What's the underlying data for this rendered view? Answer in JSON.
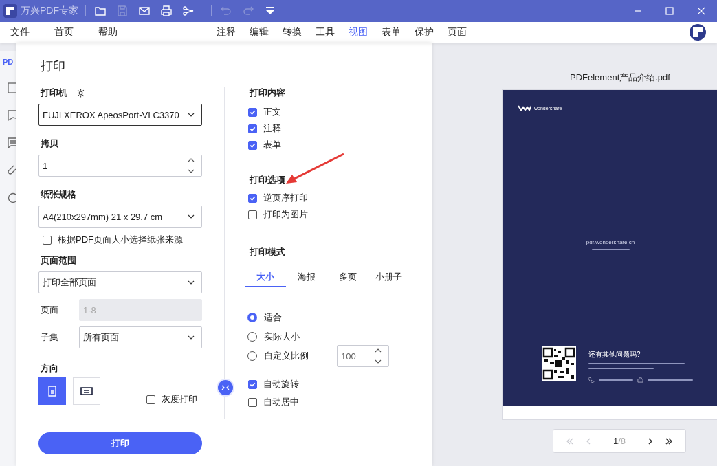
{
  "app": {
    "title": "万兴PDF专家"
  },
  "toolbar": [
    {
      "kind": "folder",
      "disabled": false
    },
    {
      "kind": "save",
      "disabled": true
    },
    {
      "kind": "mail",
      "disabled": false
    },
    {
      "kind": "print",
      "disabled": false
    },
    {
      "kind": "share",
      "disabled": false
    },
    {
      "kind": "undo",
      "disabled": true
    },
    {
      "kind": "redo",
      "disabled": true
    },
    {
      "kind": "dropdown",
      "disabled": false
    }
  ],
  "menu_left": [
    {
      "label": "文件"
    },
    {
      "label": "首页"
    },
    {
      "label": "帮助"
    }
  ],
  "menu_tabs": [
    {
      "label": "注释",
      "selected": false
    },
    {
      "label": "编辑",
      "selected": false
    },
    {
      "label": "转换",
      "selected": false
    },
    {
      "label": "工具",
      "selected": false
    },
    {
      "label": "视图",
      "selected": true
    },
    {
      "label": "表单",
      "selected": false
    },
    {
      "label": "保护",
      "selected": false
    },
    {
      "label": "页面",
      "selected": false
    }
  ],
  "sidebar": {
    "tab": "PD"
  },
  "dialog": {
    "title": "打印",
    "printer": {
      "label": "打印机",
      "value": "FUJI XEROX ApeosPort-VI C3370"
    },
    "copies": {
      "label": "拷贝",
      "value": "1"
    },
    "paper": {
      "label": "纸张规格",
      "value": "A4(210x297mm) 21 x 29.7 cm",
      "source": {
        "label": "根据PDF页面大小选择纸张来源",
        "checked": false
      }
    },
    "range": {
      "label": "页面范围",
      "value": "打印全部页面",
      "pages": {
        "label": "页面",
        "value": "1-8",
        "disabled": true
      },
      "subset": {
        "label": "子集",
        "value": "所有页面"
      }
    },
    "orientation": {
      "label": "方向",
      "options": [
        {
          "kind": "portrait",
          "selected": true
        },
        {
          "kind": "landscape",
          "selected": false
        }
      ]
    },
    "grayscale": {
      "label": "灰度打印",
      "checked": false
    },
    "print_button": "打印",
    "content": {
      "label": "打印内容",
      "items": [
        {
          "label": "正文",
          "checked": true
        },
        {
          "label": "注释",
          "checked": true
        },
        {
          "label": "表单",
          "checked": true
        }
      ]
    },
    "options": {
      "label": "打印选项",
      "items": [
        {
          "label": "逆页序打印",
          "checked": true
        },
        {
          "label": "打印为图片",
          "checked": false
        }
      ]
    },
    "mode": {
      "label": "打印模式",
      "tabs": [
        {
          "label": "大小",
          "selected": true
        },
        {
          "label": "海报",
          "selected": false
        },
        {
          "label": "多页",
          "selected": false
        },
        {
          "label": "小册子",
          "selected": false
        }
      ],
      "scale": [
        {
          "label": "适合",
          "selected": true
        },
        {
          "label": "实际大小",
          "selected": false
        },
        {
          "label": "自定义比例",
          "selected": false
        }
      ],
      "custom_value": "100",
      "extra": [
        {
          "label": "自动旋转",
          "checked": true
        },
        {
          "label": "自动居中",
          "checked": false
        }
      ]
    }
  },
  "preview": {
    "filename": "PDFelement产品介绍.pdf",
    "page": {
      "logo": "wondershare",
      "url": "pdf.wondershare.cn",
      "question": "还有其他问题吗?"
    },
    "pager": {
      "current": "1",
      "total": "/8"
    }
  }
}
